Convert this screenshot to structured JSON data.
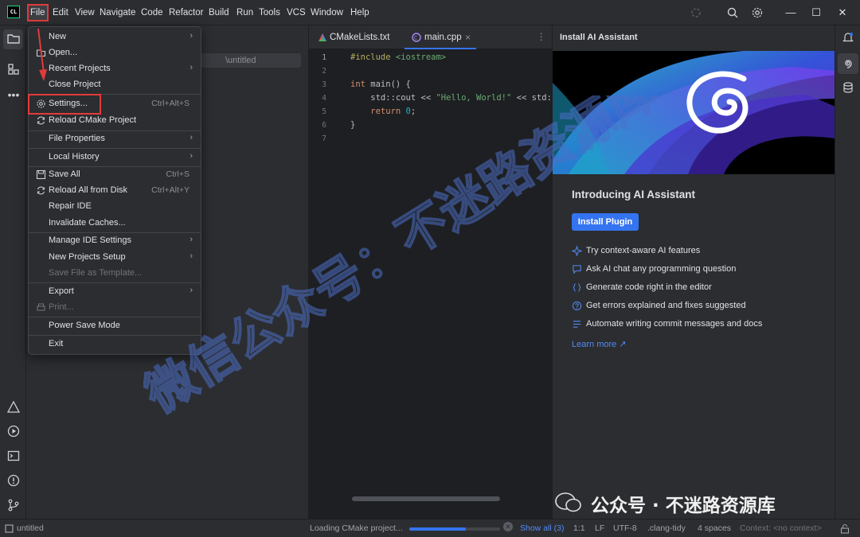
{
  "app": {
    "logo_text": "CL"
  },
  "menubar": [
    {
      "label": "File",
      "active": true
    },
    {
      "label": "Edit"
    },
    {
      "label": "View"
    },
    {
      "label": "Navigate"
    },
    {
      "label": "Code"
    },
    {
      "label": "Refactor"
    },
    {
      "label": "Build"
    },
    {
      "label": "Run"
    },
    {
      "label": "Tools"
    },
    {
      "label": "VCS"
    },
    {
      "label": "Window"
    },
    {
      "label": "Help"
    }
  ],
  "project_panel": {
    "path_fragment": "\\untitled"
  },
  "file_menu": {
    "items": [
      {
        "label": "New",
        "arrow": true
      },
      {
        "label": "Open...",
        "icon": "folder-icon"
      },
      {
        "label": "Recent Projects",
        "arrow": true
      },
      {
        "label": "Close Project"
      },
      {
        "label": "Settings...",
        "icon": "gear-icon",
        "shortcut": "Ctrl+Alt+S",
        "highlighted": true
      },
      {
        "label": "Reload CMake Project",
        "icon": "reload-icon"
      },
      {
        "label": "File Properties",
        "arrow": true
      },
      {
        "label": "Local History",
        "arrow": true
      },
      {
        "label": "Save All",
        "icon": "save-icon",
        "shortcut": "Ctrl+S"
      },
      {
        "label": "Reload All from Disk",
        "icon": "reload-icon",
        "shortcut": "Ctrl+Alt+Y"
      },
      {
        "label": "Repair IDE"
      },
      {
        "label": "Invalidate Caches..."
      },
      {
        "label": "Manage IDE Settings",
        "arrow": true
      },
      {
        "label": "New Projects Setup",
        "arrow": true
      },
      {
        "label": "Save File as Template...",
        "disabled": true
      },
      {
        "label": "Export",
        "arrow": true
      },
      {
        "label": "Print...",
        "icon": "print-icon",
        "disabled": true
      },
      {
        "label": "Power Save Mode"
      },
      {
        "label": "Exit"
      }
    ]
  },
  "editor": {
    "tabs": [
      {
        "label": "CMakeLists.txt",
        "active": false
      },
      {
        "label": "main.cpp",
        "active": true,
        "close": "×"
      }
    ],
    "more_icon": "⋮",
    "line_numbers": [
      "1",
      "2",
      "3",
      "4",
      "5",
      "6",
      "7"
    ],
    "code": {
      "l1_pp": "#include",
      "l1_inc": "<iostream>",
      "l3_kw": "int",
      "l3_rest": " main() {",
      "l4_a": "    std::cout << ",
      "l4_str": "\"Hello, World!\"",
      "l4_b": " << std:",
      "l5_kw": "    return",
      "l5_num": " 0",
      "l5_end": ";",
      "l6": "}"
    }
  },
  "ai_panel": {
    "title": "Install AI Assistant",
    "heading": "Introducing AI Assistant",
    "install_button": "Install Plugin",
    "features": [
      {
        "icon": "sparkle-icon",
        "text": "Try context-aware AI features"
      },
      {
        "icon": "chat-icon",
        "text": "Ask AI chat any programming question"
      },
      {
        "icon": "code-braces-icon",
        "text": "Generate code right in the editor"
      },
      {
        "icon": "question-icon",
        "text": "Get errors explained and fixes suggested"
      },
      {
        "icon": "list-icon",
        "text": "Automate writing commit messages and docs"
      }
    ],
    "learn_more": "Learn more ↗"
  },
  "statusbar": {
    "project": "untitled",
    "loading": "Loading CMake project...",
    "progress": 0.62,
    "show_all": "Show all (3)",
    "position": "1:1",
    "line_sep": "LF",
    "encoding": "UTF-8",
    "clang_tidy": ".clang-tidy",
    "indent": "4 spaces",
    "context": "Context: <no context>"
  },
  "watermark": {
    "text": "微信公众号：不迷路资源库",
    "footer": "公众号 · 不迷路资源库"
  },
  "colors": {
    "accent": "#3574f0",
    "highlight": "#e23b3b",
    "bg": "#1e1f22",
    "panel": "#2b2d30"
  }
}
